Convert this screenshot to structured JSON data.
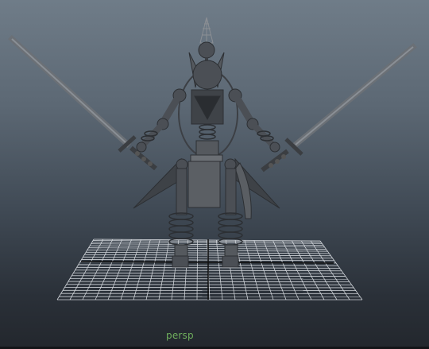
{
  "viewport": {
    "camera_label": "persp",
    "background_top": "#6f7c88",
    "background_bottom": "#23272d",
    "grid_color": "#cfd3d8",
    "grid_axis_color": "#111111",
    "model_color": "#4b4f55"
  }
}
